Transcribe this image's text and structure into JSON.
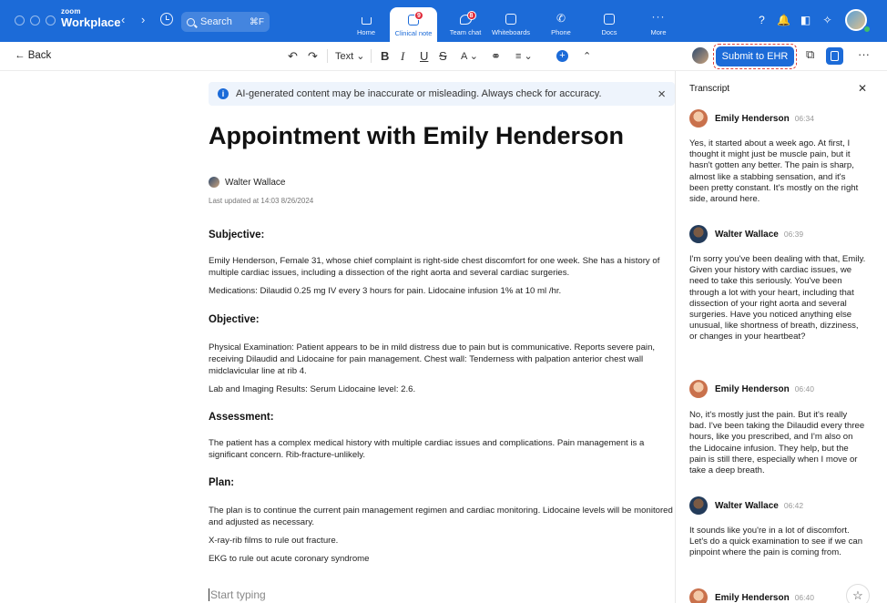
{
  "app": {
    "brand_small": "zoom",
    "brand_name": "Workplace",
    "search_label": "Search",
    "search_shortcut": "⌘F",
    "tabs": [
      {
        "label": "Home",
        "badge": ""
      },
      {
        "label": "Clinical note",
        "badge": "9"
      },
      {
        "label": "Team chat",
        "badge": "8"
      },
      {
        "label": "Whiteboards",
        "badge": ""
      },
      {
        "label": "Phone",
        "badge": ""
      },
      {
        "label": "Docs",
        "badge": ""
      },
      {
        "label": "More",
        "badge": ""
      }
    ],
    "accent_color": "#1c6bd8"
  },
  "toolbar": {
    "back_label": "← Back",
    "text_style_label": "Text",
    "submit_label": "Submit to EHR"
  },
  "document": {
    "banner_text": "AI-generated content may be inaccurate or misleading. Always check for accuracy.",
    "title": "Appointment with Emily Henderson",
    "author": "Walter Wallace",
    "last_updated": "Last updated at 14:03 8/26/2024",
    "subjective_heading": "Subjective:",
    "subjective_p1": "Emily Henderson, Female 31, whose chief complaint is right-side chest discomfort for one week. She has a history of multiple cardiac issues, including a dissection of the right aorta and several cardiac surgeries.",
    "subjective_p2": "Medications: Dilaudid 0.25 mg IV every 3 hours for pain. Lidocaine infusion 1% at 10 ml /hr.",
    "objective_heading": "Objective:",
    "objective_p1": "Physical Examination: Patient appears to be in mild distress due to pain but is communicative. Reports severe pain, receiving Dilaudid and Lidocaine for pain management. Chest wall: Tenderness with palpation anterior chest wall midclavicular line at rib 4.",
    "objective_p2": "Lab and Imaging Results: Serum Lidocaine level: 2.6.",
    "assessment_heading": "Assessment:",
    "assessment_p1": "The patient has a complex medical history with multiple cardiac issues and complications. Pain management is a significant concern. Rib-fracture-unlikely.",
    "plan_heading": "Plan:",
    "plan_p1": "The plan is to continue the current pain management regimen and cardiac monitoring. Lidocaine levels will be monitored and adjusted as necessary.",
    "plan_p2": "X-ray-rib films to rule out fracture.",
    "plan_p3": "EKG to rule out acute coronary syndrome",
    "start_placeholder": "Start typing"
  },
  "transcript": {
    "title": "Transcript",
    "entries": [
      {
        "speaker": "Emily Henderson",
        "time": "06:34",
        "text": "Yes, it started about a week ago. At first, I thought it might just be muscle pain, but it hasn't gotten any better. The pain is sharp, almost like a stabbing sensation, and it's been pretty constant. It's mostly on the right side, around here."
      },
      {
        "speaker": "Walter Wallace",
        "time": "06:39",
        "text": "I'm sorry you've been dealing with that, Emily. Given your history with cardiac issues, we need to take this seriously. You've been through a lot with your heart, including that dissection of your right aorta and several surgeries. Have you noticed anything else unusual, like shortness of breath, dizziness, or changes in your heartbeat?"
      },
      {
        "speaker": "Emily Henderson",
        "time": "06:40",
        "text": "No, it's mostly just the pain. But it's really bad. I've been taking the Dilaudid every three hours, like you prescribed, and I'm also on the Lidocaine infusion. They help, but the pain is still there, especially when I move or take a deep breath."
      },
      {
        "speaker": "Walter Wallace",
        "time": "06:42",
        "text": "It sounds like you're in a lot of discomfort. Let's do a quick examination to see if we can pinpoint where the pain is coming from."
      },
      {
        "speaker": "Emily Henderson",
        "time": "06:40",
        "text": ""
      }
    ]
  }
}
